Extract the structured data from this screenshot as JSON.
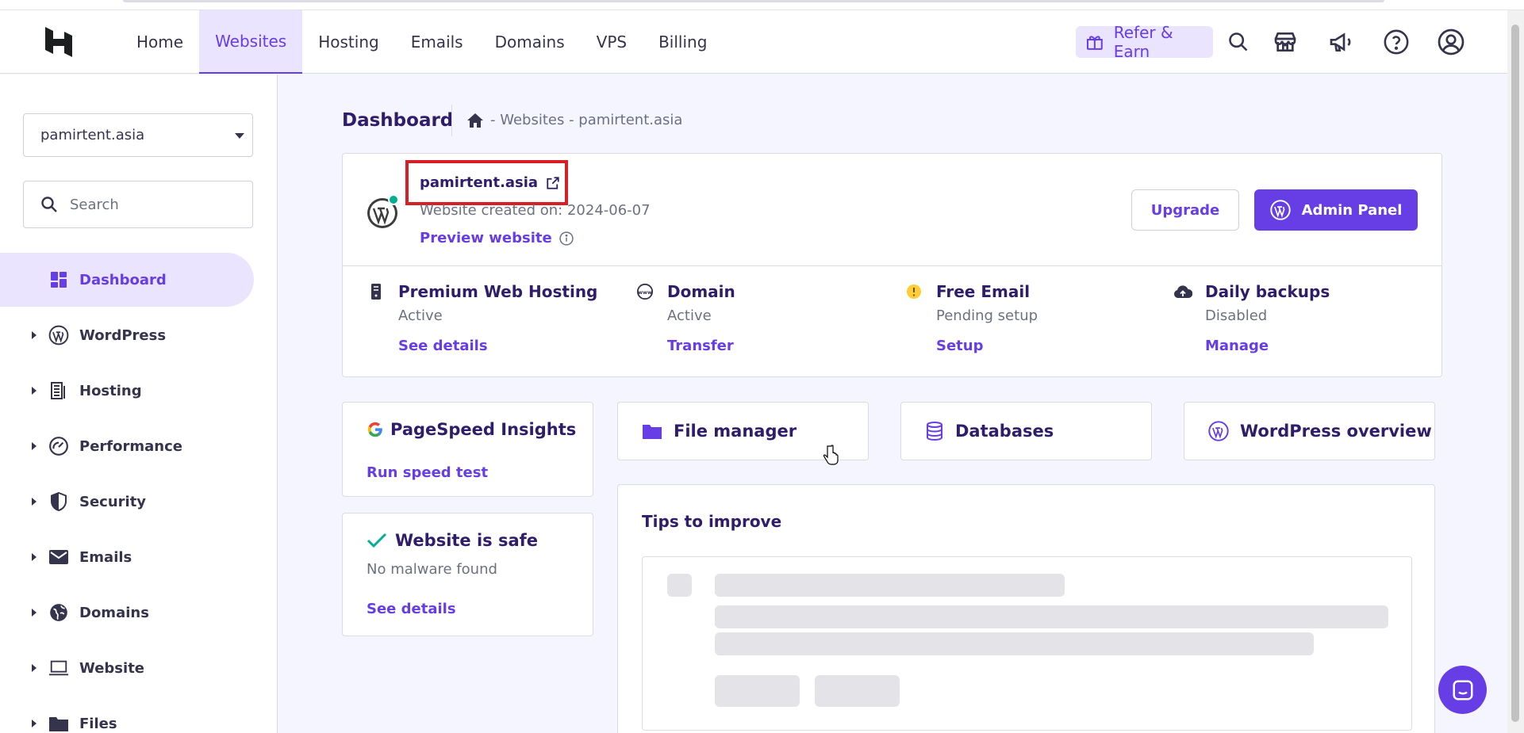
{
  "header": {
    "nav": [
      "Home",
      "Websites",
      "Hosting",
      "Emails",
      "Domains",
      "VPS",
      "Billing"
    ],
    "active_nav": "Websites",
    "refer_label": "Refer & Earn"
  },
  "sidebar": {
    "site_select": "pamirtent.asia",
    "search_placeholder": "Search",
    "items": [
      {
        "label": "Dashboard",
        "icon": "dashboard-icon",
        "active": true
      },
      {
        "label": "WordPress",
        "icon": "wordpress-icon"
      },
      {
        "label": "Hosting",
        "icon": "hosting-icon"
      },
      {
        "label": "Performance",
        "icon": "gauge-icon"
      },
      {
        "label": "Security",
        "icon": "shield-icon"
      },
      {
        "label": "Emails",
        "icon": "mail-icon"
      },
      {
        "label": "Domains",
        "icon": "globe-icon"
      },
      {
        "label": "Website",
        "icon": "laptop-icon"
      },
      {
        "label": "Files",
        "icon": "folder-icon"
      }
    ]
  },
  "breadcrumb": {
    "title": "Dashboard",
    "path": "- Websites - pamirtent.asia"
  },
  "site": {
    "name": "pamirtent.asia",
    "created": "Website created on: 2024-06-07",
    "preview_label": "Preview website",
    "upgrade_label": "Upgrade",
    "admin_label": "Admin Panel"
  },
  "services": [
    {
      "title": "Premium Web Hosting",
      "status": "Active",
      "link": "See details",
      "icon": "server-icon"
    },
    {
      "title": "Domain",
      "status": "Active",
      "link": "Transfer",
      "icon": "www-icon"
    },
    {
      "title": "Free Email",
      "status": "Pending setup",
      "link": "Setup",
      "icon": "warning-dot-icon"
    },
    {
      "title": "Daily backups",
      "status": "Disabled",
      "link": "Manage",
      "icon": "cloud-upload-icon"
    }
  ],
  "pagespeed": {
    "title": "PageSpeed Insights",
    "link": "Run speed test"
  },
  "tools": [
    "File manager",
    "Databases",
    "WordPress overview"
  ],
  "safety": {
    "title": "Website is safe",
    "subtitle": "No malware found",
    "link": "See details"
  },
  "tips": {
    "title": "Tips to improve"
  },
  "colors": {
    "accent": "#673de6",
    "accent_light": "#ebe4ff",
    "text": "#2f1c6a",
    "highlight": "#d81f26"
  }
}
